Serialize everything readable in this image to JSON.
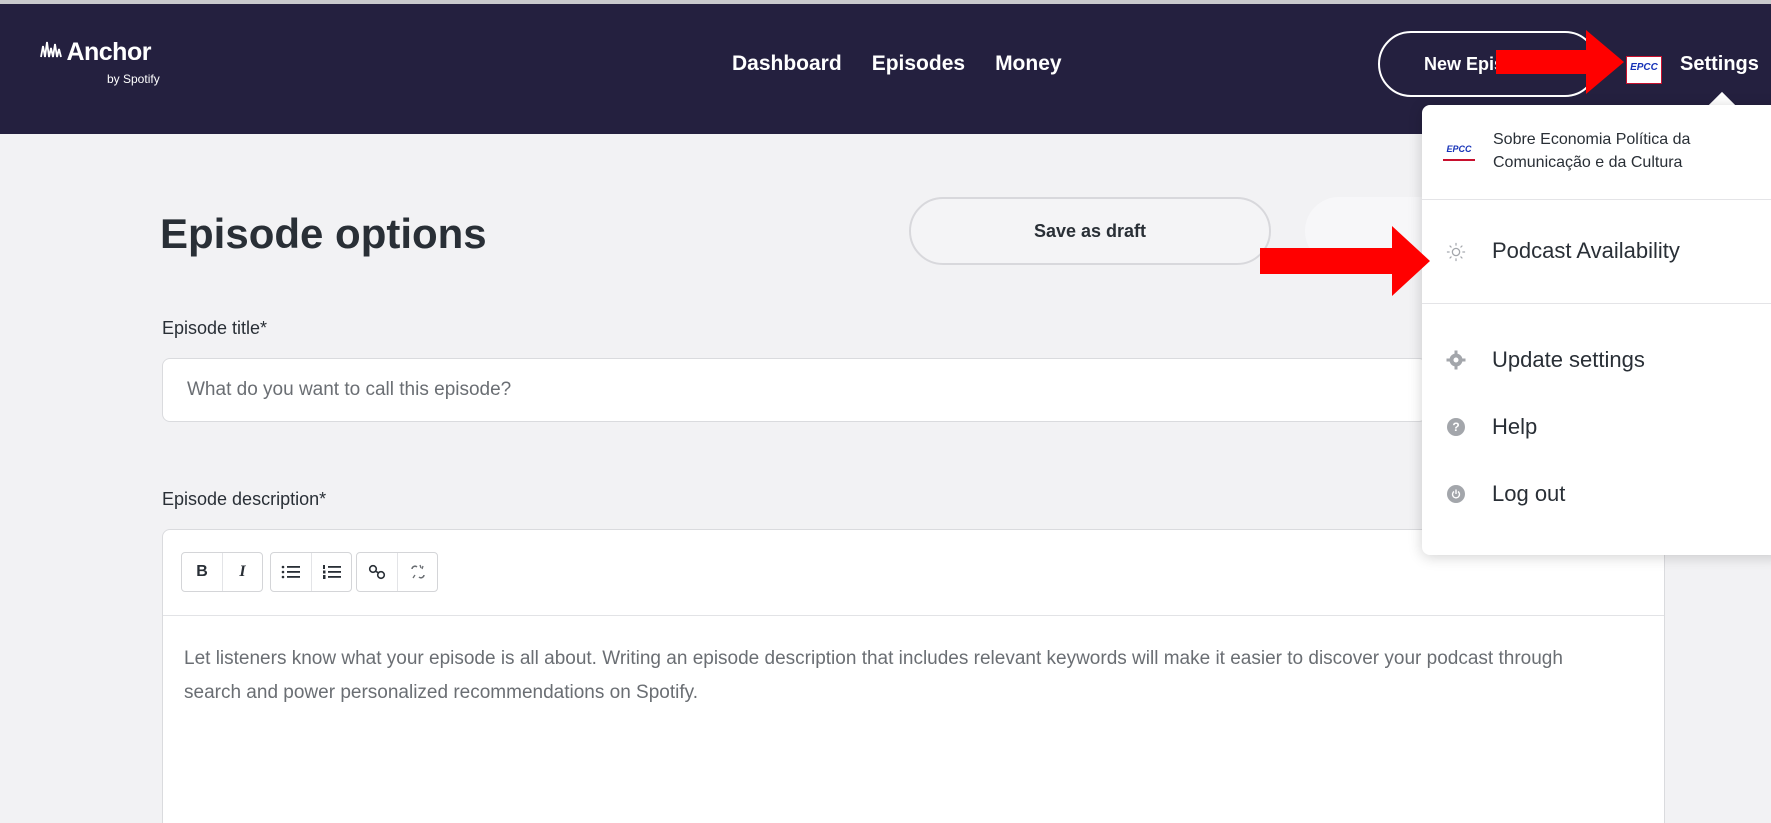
{
  "header": {
    "logo_mark": "ଠଠ",
    "logo_name": "Anchor",
    "logo_sub": "by Spotify",
    "nav": [
      {
        "label": "Dashboard"
      },
      {
        "label": "Episodes"
      },
      {
        "label": "Money"
      }
    ],
    "new_episode_label": "New Episode",
    "podcast_logo_text": "EPCC",
    "settings_label": "Settings"
  },
  "main": {
    "title": "Episode options",
    "save_draft_label": "Save as draft",
    "episode_title_label": "Episode title*",
    "episode_title_placeholder": "What do you want to call this episode?",
    "description_label": "Episode description*",
    "description_placeholder": "Let listeners know what your episode is all about. Writing an episode description that includes relevant keywords will make it easier to discover your podcast through search and power personalized recommendations on Spotify.",
    "toolbar": {
      "bold": "B",
      "italic": "I"
    }
  },
  "dropdown": {
    "account_logo_text": "EPCC",
    "account_name_line1": "Sobre Economia Política da",
    "account_name_line2": "Comunicação e da Cultura",
    "items": [
      {
        "label": "Podcast Availability",
        "icon": "sun-icon"
      },
      {
        "label": "Update settings",
        "icon": "gear-icon"
      },
      {
        "label": "Help",
        "icon": "help-icon"
      },
      {
        "label": "Log out",
        "icon": "power-icon"
      }
    ]
  },
  "colors": {
    "header_bg": "#24203f",
    "arrow": "#ff0000"
  }
}
